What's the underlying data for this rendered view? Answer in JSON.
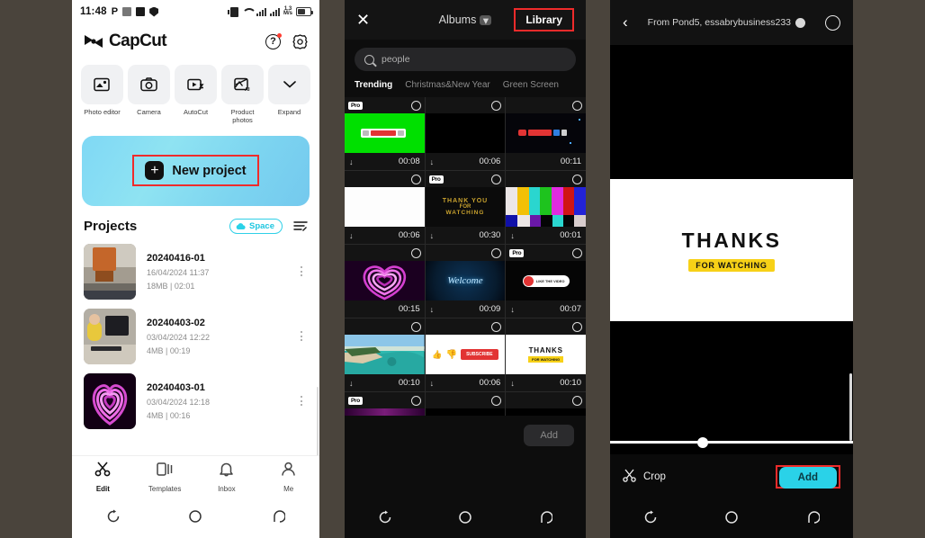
{
  "panel1": {
    "status_bar": {
      "time": "11:48",
      "p_label": "P",
      "icons": [
        "vibrate-icon",
        "wifi-icon",
        "signal-icon",
        "signal-icon",
        "battery-icon"
      ],
      "data_speed": "1.3",
      "data_unit": "M/s"
    },
    "app_title": "CapCut",
    "help_label": "?",
    "tools": [
      {
        "label": "Photo editor",
        "icon": "photo-editor-icon"
      },
      {
        "label": "Camera",
        "icon": "camera-icon"
      },
      {
        "label": "AutoCut",
        "icon": "autocut-icon"
      },
      {
        "label": "Product photos",
        "icon": "product-photos-icon"
      },
      {
        "label": "Expand",
        "icon": "chevron-down-icon"
      }
    ],
    "banner": {
      "new_project_label": "New project",
      "plus": "+"
    },
    "projects_header": {
      "title": "Projects",
      "space_label": "Space",
      "sort_icon": "sort-icon"
    },
    "projects": [
      {
        "title": "20240416-01",
        "date": "16/04/2024 11:37",
        "size": "18MB",
        "separator": "|",
        "duration": "02:01"
      },
      {
        "title": "20240403-02",
        "date": "03/04/2024 12:22",
        "size": "4MB",
        "separator": "|",
        "duration": "00:19"
      },
      {
        "title": "20240403-01",
        "date": "03/04/2024 12:18",
        "size": "4MB",
        "separator": "|",
        "duration": "00:16"
      }
    ],
    "tabs": [
      {
        "label": "Edit",
        "icon": "scissors-icon",
        "active": true
      },
      {
        "label": "Templates",
        "icon": "templates-icon",
        "active": false
      },
      {
        "label": "Inbox",
        "icon": "bell-icon",
        "active": false
      },
      {
        "label": "Me",
        "icon": "person-icon",
        "active": false
      }
    ],
    "nav": {
      "recent": "recent-apps-icon",
      "home": "home-icon",
      "back": "back-icon"
    }
  },
  "panel2": {
    "header": {
      "close": "close-icon",
      "albums_label": "Albums",
      "library_label": "Library"
    },
    "search": {
      "value": "people",
      "icon": "search-icon"
    },
    "categories": [
      {
        "label": "Trending",
        "active": true
      },
      {
        "label": "Christmas&New Year",
        "active": false
      },
      {
        "label": "Green Screen",
        "active": false
      }
    ],
    "media": [
      {
        "pro": true,
        "duration": "00:08",
        "download": true,
        "kind": "green-screen"
      },
      {
        "pro": false,
        "duration": "00:06",
        "download": true,
        "kind": "black"
      },
      {
        "pro": false,
        "duration": "00:11",
        "download": false,
        "kind": "subscribe-dark"
      },
      {
        "pro": false,
        "duration": "00:06",
        "download": true,
        "kind": "white"
      },
      {
        "pro": true,
        "duration": "00:30",
        "download": true,
        "kind": "thankyou-gold"
      },
      {
        "pro": false,
        "duration": "00:01",
        "download": true,
        "kind": "color-bars"
      },
      {
        "pro": false,
        "duration": "00:15",
        "download": false,
        "kind": "neon-heart"
      },
      {
        "pro": false,
        "duration": "00:09",
        "download": true,
        "kind": "welcome-blue"
      },
      {
        "pro": true,
        "duration": "00:07",
        "download": true,
        "kind": "like-video"
      },
      {
        "pro": false,
        "duration": "00:10",
        "download": true,
        "kind": "beach"
      },
      {
        "pro": false,
        "duration": "00:06",
        "download": true,
        "kind": "subscribe-white"
      },
      {
        "pro": false,
        "duration": "00:10",
        "download": true,
        "kind": "thanks-white"
      },
      {
        "pro": true,
        "duration": "",
        "download": false,
        "kind": "purple-partial"
      },
      {
        "pro": false,
        "duration": "",
        "download": false,
        "kind": "black"
      },
      {
        "pro": false,
        "duration": "",
        "download": false,
        "kind": "black"
      }
    ],
    "add_label": "Add",
    "nav": {
      "recent": "recent-apps-icon",
      "home": "home-icon",
      "back": "back-icon"
    }
  },
  "panel3": {
    "header": {
      "back": "back-arrow-icon",
      "title": "From Pond5, essabrybusiness233",
      "select": "select-circle-icon"
    },
    "preview": {
      "main_text": "THANKS",
      "sub_text": "FOR WATCHING",
      "highlight_color": "#f7d117"
    },
    "slider": {
      "position_percent": 36
    },
    "crop_label": "Crop",
    "add_label": "Add",
    "nav": {
      "recent": "recent-apps-icon",
      "home": "home-icon",
      "back": "back-icon"
    }
  }
}
